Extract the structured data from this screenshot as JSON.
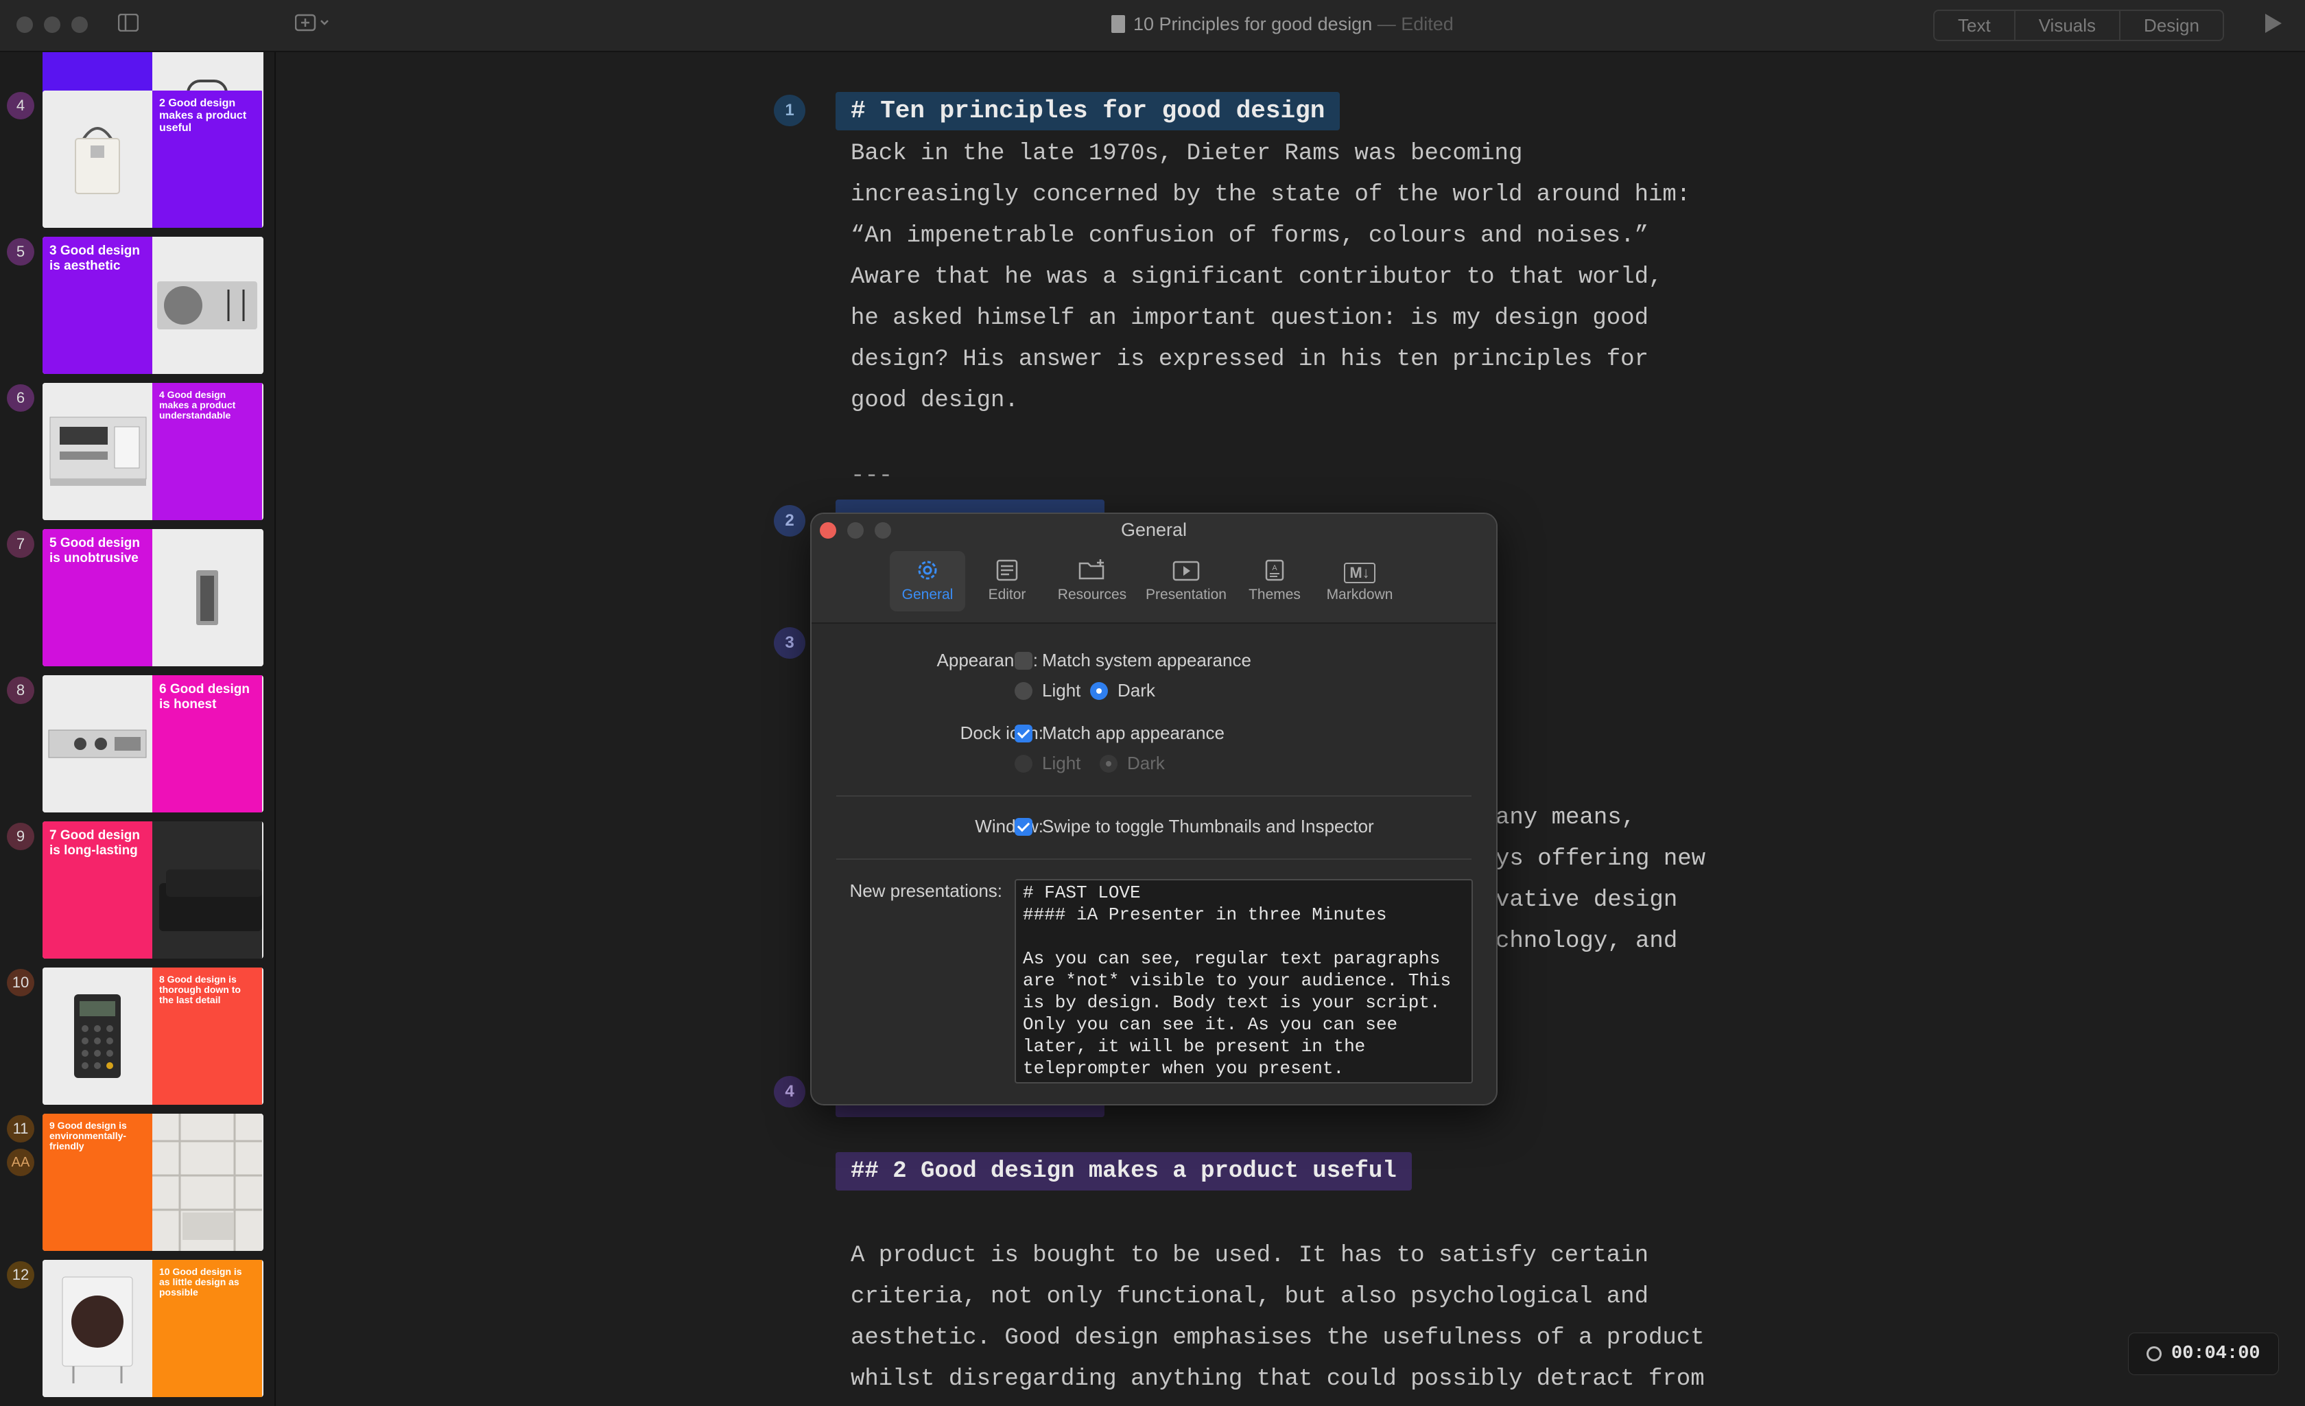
{
  "window": {
    "doc_title": "10 Principles for good design",
    "doc_status": "— Edited",
    "view_tabs": [
      "Text",
      "Visuals",
      "Design"
    ]
  },
  "sidebar": {
    "slides": [
      {
        "num": "4",
        "caption": "2 Good design makes a product useful",
        "color": "#7b10f0",
        "layout": "photo-left",
        "product": "tote-bag",
        "badge": "#5b2c63"
      },
      {
        "num": "5",
        "caption": "3 Good design is aesthetic",
        "color": "#8a10ee",
        "layout": "caption-left",
        "product": "radio",
        "badge": "#5b2c63"
      },
      {
        "num": "6",
        "caption": "4 Good design makes a product understandable",
        "color": "#b513e8",
        "layout": "photo-left",
        "product": "hifi-unit",
        "badge": "#5b2c63"
      },
      {
        "num": "7",
        "caption": "5 Good design is unobtrusive",
        "color": "#d010dc",
        "layout": "caption-left",
        "product": "speaker",
        "badge": "#5b2c4a"
      },
      {
        "num": "8",
        "caption": "6 Good design is honest",
        "color": "#ee10b8",
        "layout": "photo-left",
        "product": "tape-deck",
        "badge": "#5b2c4a"
      },
      {
        "num": "9",
        "caption": "7 Good design is long-lasting",
        "color": "#f5246a",
        "layout": "caption-left",
        "product": "sofa",
        "badge": "#5b2c3a"
      },
      {
        "num": "10",
        "caption": "8 Good design is thorough down to the last detail",
        "color": "#fa4a3c",
        "layout": "photo-left",
        "product": "calculator",
        "badge": "#5a3020"
      },
      {
        "num": "11",
        "caption": "9 Good design is environmentally-friendly",
        "color": "#fa6a16",
        "layout": "caption-left",
        "product": "shelving",
        "badge": "#5a3a14"
      },
      {
        "num": "12",
        "caption": "10 Good design is as little design as possible",
        "color": "#fb8a10",
        "layout": "photo-left",
        "product": "record-player",
        "badge": "#5a3f12"
      }
    ],
    "aa_label": "AA"
  },
  "editor": {
    "heading1": "# Ten principles for good design",
    "intro": [
      "Back in the late 1970s, Dieter Rams was becoming",
      "increasingly concerned by the state of the world around him:",
      "“An impenetrable confusion of forms, colours and noises.”",
      "Aware that he was a significant contributor to that world,",
      "he asked himself an important question: is my design good",
      "design? His answer is expressed in his ten principles for",
      "good design."
    ],
    "rule": "---",
    "partial_lines": [
      "any means,",
      "ys offering new",
      "vative design",
      "chnology, and"
    ],
    "heading2": "## 2 Good design makes a product useful",
    "para2": [
      "A product is bought to be used. It has to satisfy certain",
      "criteria, not only functional, but also psychological and",
      "aesthetic. Good design emphasises the usefulness of a product",
      "whilst disregarding anything that could possibly detract from"
    ],
    "markers": [
      "1",
      "2",
      "3",
      "4"
    ],
    "timer": "00:04:00"
  },
  "dialog": {
    "title": "General",
    "tabs": [
      {
        "label": "General",
        "icon": "gear-icon",
        "selected": true
      },
      {
        "label": "Editor",
        "icon": "editor-icon"
      },
      {
        "label": "Resources",
        "icon": "folder-plus-icon"
      },
      {
        "label": "Presentation",
        "icon": "play-icon"
      },
      {
        "label": "Themes",
        "icon": "themes-icon"
      },
      {
        "label": "Markdown",
        "icon": "markdown-icon"
      }
    ],
    "appearance_label": "Appearance:",
    "match_system": "Match system appearance",
    "light": "Light",
    "dark": "Dark",
    "dock_label": "Dock icon:",
    "match_app": "Match app appearance",
    "window_label": "Window:",
    "swipe_toggle": "Swipe to toggle Thumbnails and Inspector",
    "new_presentations_label": "New presentations:",
    "template_text": "# FAST LOVE\n#### iA Presenter in three Minutes\n\nAs you can see, regular text paragraphs\nare *not* visible to your audience. This\nis by design. Body text is your script.\nOnly you can see it. As you can see\nlater, it will be present in the\nteleprompter when you present.",
    "markdown_icon_text": "M↓"
  }
}
